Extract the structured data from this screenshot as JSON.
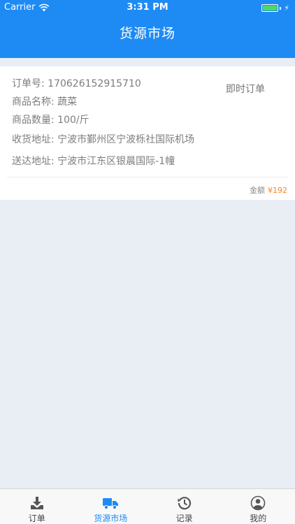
{
  "status_bar": {
    "carrier": "Carrier",
    "time": "3:31 PM"
  },
  "nav": {
    "title": "货源市场"
  },
  "order": {
    "order_no": "订单号: 170626152915710",
    "product_name": "商品名称: 蔬菜",
    "product_qty": "商品数量: 100/斤",
    "pickup_addr": "收货地址: 宁波市鄞州区宁波栎社国际机场",
    "delivery_addr": "送达地址: 宁波市江东区银晨国际-1幢",
    "type_tag": "即时订单",
    "amount_label": "金额",
    "amount_value": "¥192"
  },
  "tabs": [
    {
      "label": "订单",
      "icon": "download-tray-icon",
      "active": false
    },
    {
      "label": "货源市场",
      "icon": "truck-icon",
      "active": true
    },
    {
      "label": "记录",
      "icon": "history-icon",
      "active": false
    },
    {
      "label": "我的",
      "icon": "user-circle-icon",
      "active": false
    }
  ],
  "colors": {
    "primary": "#1E8BF5",
    "amount": "#F5842A",
    "background": "#E9EDF4"
  }
}
